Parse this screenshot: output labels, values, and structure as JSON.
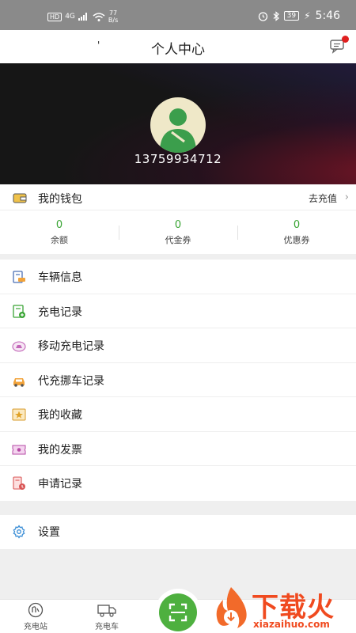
{
  "status_bar": {
    "hd": "HD",
    "signal": "4G",
    "speed_value": "77",
    "speed_unit": "B/s",
    "battery": "39",
    "time": "5:46"
  },
  "nav": {
    "dot": "'",
    "title": "个人中心"
  },
  "profile": {
    "phone": "13759934712"
  },
  "wallet": {
    "label": "我的钱包",
    "recharge": "去充值",
    "stats": [
      {
        "value": "0",
        "label": "余额"
      },
      {
        "value": "0",
        "label": "代金券"
      },
      {
        "value": "0",
        "label": "优惠券"
      }
    ]
  },
  "menu": {
    "items": [
      {
        "label": "车辆信息",
        "icon": "vehicle-info-icon"
      },
      {
        "label": "充电记录",
        "icon": "charge-record-icon"
      },
      {
        "label": "移动充电记录",
        "icon": "mobile-charge-icon"
      },
      {
        "label": "代充挪车记录",
        "icon": "car-move-icon"
      },
      {
        "label": "我的收藏",
        "icon": "star-icon"
      },
      {
        "label": "我的发票",
        "icon": "invoice-icon"
      },
      {
        "label": "申请记录",
        "icon": "application-icon"
      }
    ]
  },
  "settings": {
    "label": "设置",
    "icon": "gear-icon"
  },
  "tabbar": {
    "tabs": [
      {
        "label": "充电站",
        "icon": "charging-station-icon"
      },
      {
        "label": "充电车",
        "icon": "charging-truck-icon"
      }
    ],
    "scan_icon": "scan-icon"
  },
  "watermark": {
    "text": "下载火",
    "sub": "xiazaihuo.com"
  },
  "colors": {
    "accent_green": "#3aa535",
    "scan_green": "#4eb03f",
    "badge_red": "#e02020",
    "watermark_orange": "#f04a1f"
  }
}
